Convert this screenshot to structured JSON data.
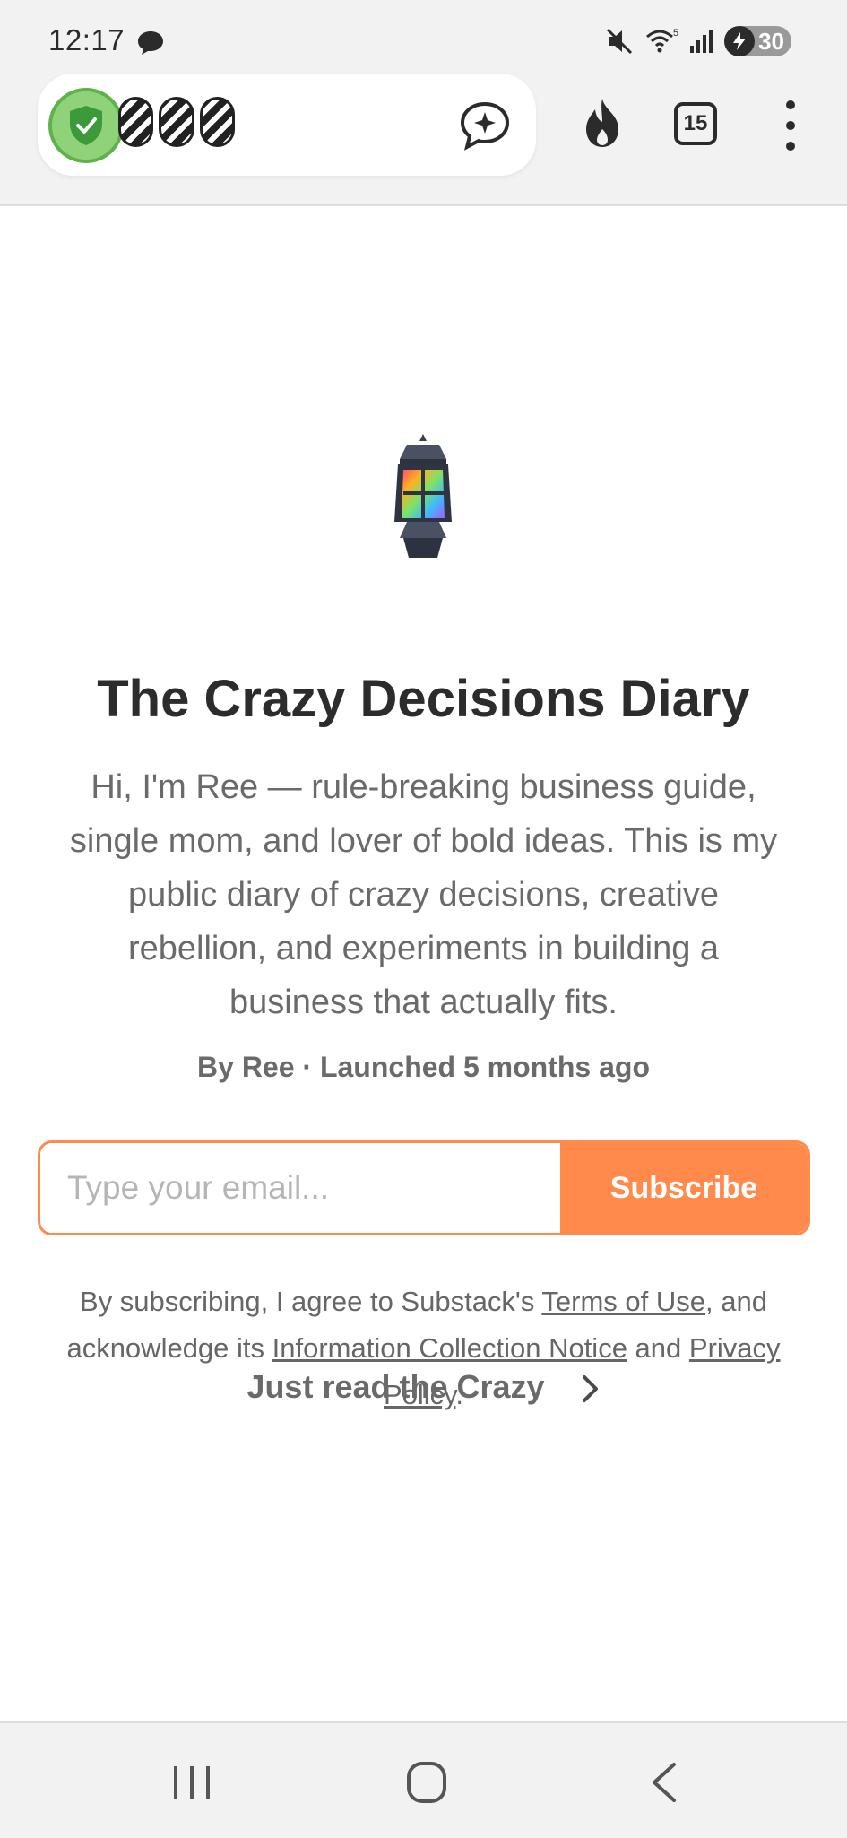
{
  "status_bar": {
    "time": "12:17",
    "battery": "30",
    "wifi_label": "5"
  },
  "browser": {
    "tab_count": "15",
    "icons": {
      "security": "shield-check-icon",
      "ai_chat": "sparkle-chat-icon",
      "trending": "flame-icon",
      "tabs": "tabs-icon",
      "menu": "more-vertical-icon"
    },
    "colors": {
      "shield": "#8fd27a"
    }
  },
  "publication": {
    "title": "The Crazy Decisions Diary",
    "description": "Hi, I'm Ree — rule-breaking business guide, single mom, and lover of bold ideas. This is my public diary of crazy decisions, creative rebellion, and experiments in building a business that actually fits.",
    "byline": "By Ree · Launched 5 months ago"
  },
  "subscribe": {
    "email_placeholder": "Type your email...",
    "button_label": "Subscribe",
    "accent_color": "#ff8a4c"
  },
  "legal": {
    "prefix": "By subscribing, I agree to Substack's ",
    "terms_link": "Terms of Use",
    "middle": ", and acknowledge its ",
    "info_link": "Information Collection Notice",
    "and": " and ",
    "privacy_link": "Privacy Policy",
    "suffix": "."
  },
  "just_read": {
    "label": "Just read the Crazy"
  },
  "nav": {
    "icons": [
      "recent-apps-icon",
      "home-icon",
      "back-icon"
    ]
  }
}
